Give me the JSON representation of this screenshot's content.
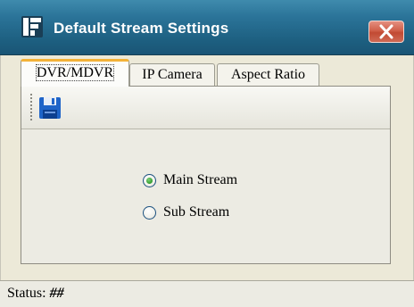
{
  "window": {
    "title": "Default Stream Settings",
    "accent": "#2b7499",
    "close_icon": "close-x"
  },
  "tabs": [
    {
      "label": "DVR/MDVR",
      "active": true
    },
    {
      "label": "IP Camera",
      "active": false
    },
    {
      "label": "Aspect Ratio",
      "active": false
    }
  ],
  "toolbar": {
    "save_icon": "floppy-disk"
  },
  "stream_options": [
    {
      "label": "Main Stream",
      "checked": true
    },
    {
      "label": "Sub Stream",
      "checked": false
    }
  ],
  "status": {
    "label": "Status:",
    "value": "##"
  }
}
